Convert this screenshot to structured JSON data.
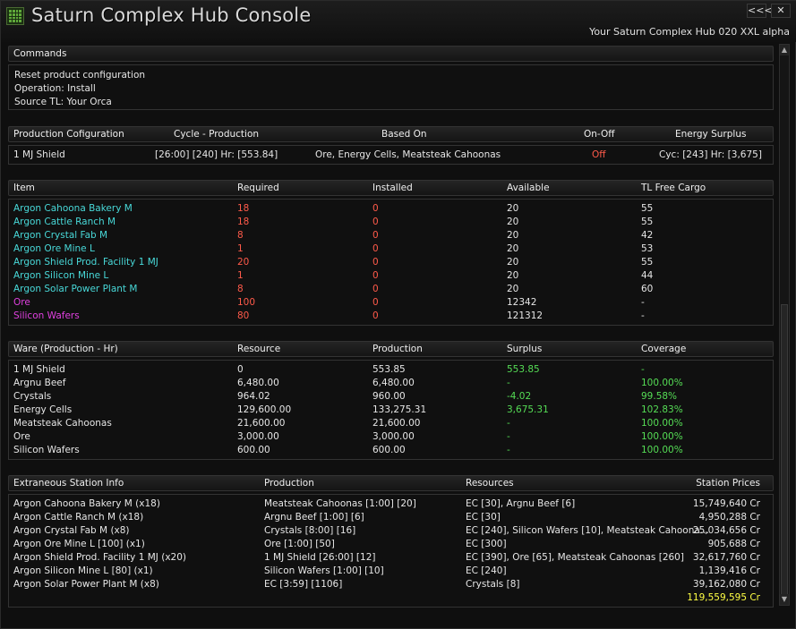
{
  "window": {
    "title": "Saturn Complex Hub Console",
    "subtitle": "Your Saturn Complex Hub 020 XXL alpha",
    "collapse_label": "<<<",
    "close_label": "✕"
  },
  "commands": {
    "header": "Commands",
    "lines": [
      "Reset product configuration",
      "Operation: Install",
      "Source TL: Your Orca"
    ]
  },
  "production": {
    "headers": [
      "Production Cofiguration",
      "Cycle - Production",
      "Based On",
      "On-Off",
      "Energy Surplus"
    ],
    "row": [
      "1 MJ Shield",
      "[26:00] [240] Hr: [553.84]",
      "Ore, Energy Cells, Meatsteak Cahoonas",
      "Off",
      "Cyc: [243] Hr: [3,675]"
    ]
  },
  "items": {
    "headers": [
      "Item",
      "Required",
      "Installed",
      "Available",
      "TL Free Cargo"
    ],
    "rows": [
      [
        "Argon Cahoona Bakery M",
        "18",
        "0",
        "20",
        "55"
      ],
      [
        "Argon Cattle Ranch M",
        "18",
        "0",
        "20",
        "55"
      ],
      [
        "Argon Crystal Fab M",
        "8",
        "0",
        "20",
        "42"
      ],
      [
        "Argon Ore Mine L",
        "1",
        "0",
        "20",
        "53"
      ],
      [
        "Argon Shield Prod. Facility 1 MJ",
        "20",
        "0",
        "20",
        "55"
      ],
      [
        "Argon Silicon Mine L",
        "1",
        "0",
        "20",
        "44"
      ],
      [
        "Argon Solar Power Plant M",
        "8",
        "0",
        "20",
        "60"
      ],
      [
        "Ore",
        "100",
        "0",
        "12342",
        "-"
      ],
      [
        "Silicon Wafers",
        "80",
        "0",
        "121312",
        "-"
      ]
    ],
    "colors": [
      "cyan",
      "cyan",
      "cyan",
      "cyan",
      "cyan",
      "cyan",
      "cyan",
      "pink",
      "pink"
    ]
  },
  "wares": {
    "headers": [
      "Ware (Production - Hr)",
      "Resource",
      "Production",
      "Surplus",
      "Coverage"
    ],
    "rows": [
      [
        "1 MJ Shield",
        "0",
        "553.85",
        "553.85",
        "-"
      ],
      [
        "Argnu Beef",
        "6,480.00",
        "6,480.00",
        "-",
        "100.00%"
      ],
      [
        "Crystals",
        "964.02",
        "960.00",
        "-4.02",
        "99.58%"
      ],
      [
        "Energy Cells",
        "129,600.00",
        "133,275.31",
        "3,675.31",
        "102.83%"
      ],
      [
        "Meatsteak Cahoonas",
        "21,600.00",
        "21,600.00",
        "-",
        "100.00%"
      ],
      [
        "Ore",
        "3,000.00",
        "3,000.00",
        "-",
        "100.00%"
      ],
      [
        "Silicon Wafers",
        "600.00",
        "600.00",
        "-",
        "100.00%"
      ]
    ]
  },
  "stations": {
    "headers": [
      "Extraneous Station Info",
      "Production",
      "Resources",
      "Station Prices"
    ],
    "rows": [
      [
        "Argon Cahoona Bakery M (x18)",
        "Meatsteak Cahoonas [1:00] [20]",
        "EC [30], Argnu Beef [6]",
        "15,749,640 Cr"
      ],
      [
        "Argon Cattle Ranch M (x18)",
        "Argnu Beef [1:00] [6]",
        "EC [30]",
        "4,950,288 Cr"
      ],
      [
        "Argon Crystal Fab M (x8)",
        "Crystals [8:00] [16]",
        "EC [240], Silicon Wafers [10], Meatsteak Cahoona...",
        "25,034,656 Cr"
      ],
      [
        "Argon Ore Mine L [100] (x1)",
        "Ore [1:00] [50]",
        "EC [300]",
        "905,688 Cr"
      ],
      [
        "Argon Shield Prod. Facility 1 MJ (x20)",
        "1 MJ Shield [26:00] [12]",
        "EC [390], Ore [65], Meatsteak Cahoonas [260]",
        "32,617,760 Cr"
      ],
      [
        "Argon Silicon Mine L [80] (x1)",
        "Silicon Wafers [1:00] [10]",
        "EC [240]",
        "1,139,416 Cr"
      ],
      [
        "Argon Solar Power Plant M (x8)",
        "EC [3:59] [1106]",
        "Crystals [8]",
        "39,162,080 Cr"
      ]
    ],
    "total": "119,559,595 Cr"
  },
  "theme": {
    "item_color": "#48d8d8",
    "ware_color": "#e040e0",
    "required_color": "#ff5a4a",
    "surplus_color": "#55dd55",
    "total_color": "#ffff44"
  }
}
